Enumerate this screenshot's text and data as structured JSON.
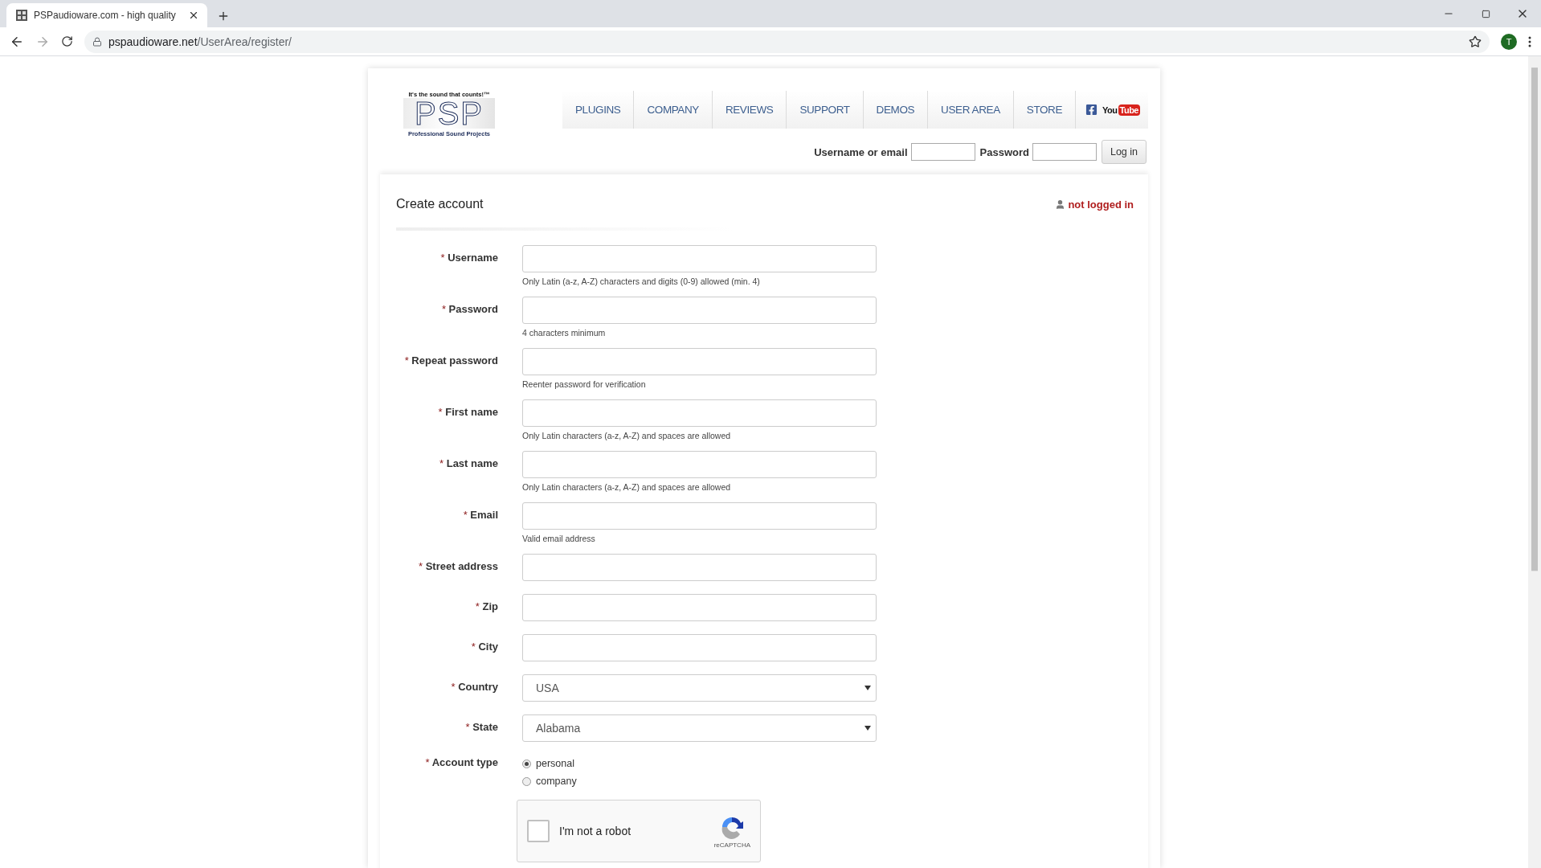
{
  "browser": {
    "tab_title": "PSPaudioware.com - high quality",
    "url_host": "pspaudioware.net",
    "url_path": "/UserArea/register/",
    "profile_initial": "T"
  },
  "logo": {
    "tagline": "It's the sound that counts!™",
    "mark": "PSP",
    "subtitle": "Professional Sound Projects"
  },
  "nav": [
    {
      "label": "PLUGINS"
    },
    {
      "label": "COMPANY"
    },
    {
      "label": "REVIEWS"
    },
    {
      "label": "SUPPORT"
    },
    {
      "label": "DEMOS"
    },
    {
      "label": "USER AREA"
    },
    {
      "label": "STORE"
    }
  ],
  "social": {
    "youtube_left": "You",
    "youtube_right": "Tube"
  },
  "login": {
    "username_label": "Username or email",
    "password_label": "Password",
    "button": "Log in"
  },
  "page": {
    "title": "Create account",
    "status": "not logged in"
  },
  "fields": [
    {
      "kind": "text",
      "mark": "*",
      "label": "Username",
      "hint": "Only Latin (a-z, A-Z) characters and digits (0-9) allowed (min. 4)"
    },
    {
      "kind": "text",
      "mark": "*",
      "label": "Password",
      "hint": "4 characters minimum"
    },
    {
      "kind": "text",
      "mark": "*",
      "label": "Repeat password",
      "hint": "Reenter password for verification"
    },
    {
      "kind": "text",
      "mark": "*",
      "label": "First name",
      "hint": "Only Latin characters (a-z, A-Z) and spaces are allowed"
    },
    {
      "kind": "text",
      "mark": "*",
      "label": "Last name",
      "hint": "Only Latin characters (a-z, A-Z) and spaces are allowed"
    },
    {
      "kind": "text",
      "mark": "*",
      "label": "Email",
      "hint": "Valid email address"
    },
    {
      "kind": "text",
      "mark": "*",
      "label": "Street address"
    },
    {
      "kind": "text",
      "mark": "*",
      "label": "Zip"
    },
    {
      "kind": "text",
      "mark": "*",
      "label": "City"
    },
    {
      "kind": "select",
      "mark": "*",
      "label": "Country",
      "value": "USA"
    },
    {
      "kind": "select",
      "mark": "*",
      "label": "State",
      "value": "Alabama"
    },
    {
      "kind": "radio",
      "mark": "*",
      "label": "Account type",
      "options": [
        {
          "label": "personal",
          "selected": true
        },
        {
          "label": "company",
          "selected": false
        }
      ]
    }
  ],
  "captcha": {
    "label": "I'm not a robot",
    "checked": false,
    "brand": "reCAPTCHA"
  }
}
